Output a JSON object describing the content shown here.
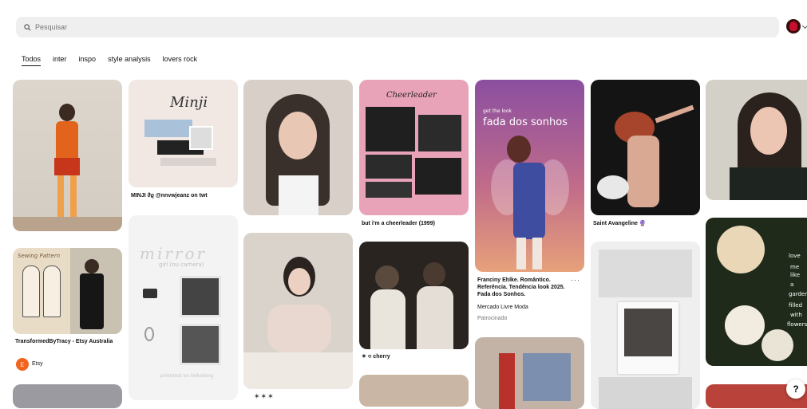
{
  "search": {
    "placeholder": "Pesquisar"
  },
  "tabs": [
    {
      "label": "Todos",
      "active": true
    },
    {
      "label": "inter",
      "active": false
    },
    {
      "label": "inspo",
      "active": false
    },
    {
      "label": "style analysis",
      "active": false
    },
    {
      "label": "lovers rock",
      "active": false
    }
  ],
  "pins": {
    "minji": {
      "caption": "MINJI ϑϱ @nnvwjeanz on twt",
      "overlay_title": "Minji"
    },
    "sewing": {
      "caption": "TransformedByTracy - Etsy Australia",
      "source": "Etsy",
      "source_initial": "E",
      "overlay": "Sewing Pattern"
    },
    "mirror": {
      "overlay_title": "mirror",
      "overlay_sub": "girl (nu camera)",
      "footer": "pinterest on behalong"
    },
    "cheer": {
      "caption": "but i'm a cheerleader (1999)",
      "overlay": "Cheerleader"
    },
    "cherry": {
      "caption": "✶ ৩ cherry"
    },
    "fada": {
      "caption": "Franciny Ehlke. Romântico. Referência. Tendência look 2025. Fada dos Sonhos.",
      "advertiser": "Mercado Livre Moda",
      "promoted": "Patrocinado",
      "overlay_small": "get the look",
      "overlay_big": "fada dos sonhos",
      "more": "···"
    },
    "saint": {
      "caption": "Saint Avangeline 🔮"
    },
    "garden": {
      "words": [
        "love",
        "me",
        "like",
        "a",
        "garden",
        "filled",
        "with",
        "flowers"
      ]
    }
  },
  "help": {
    "label": "?"
  },
  "colors": {
    "search_bg": "#efefef",
    "accent_red": "#c8102e",
    "etsy": "#f1641e"
  }
}
